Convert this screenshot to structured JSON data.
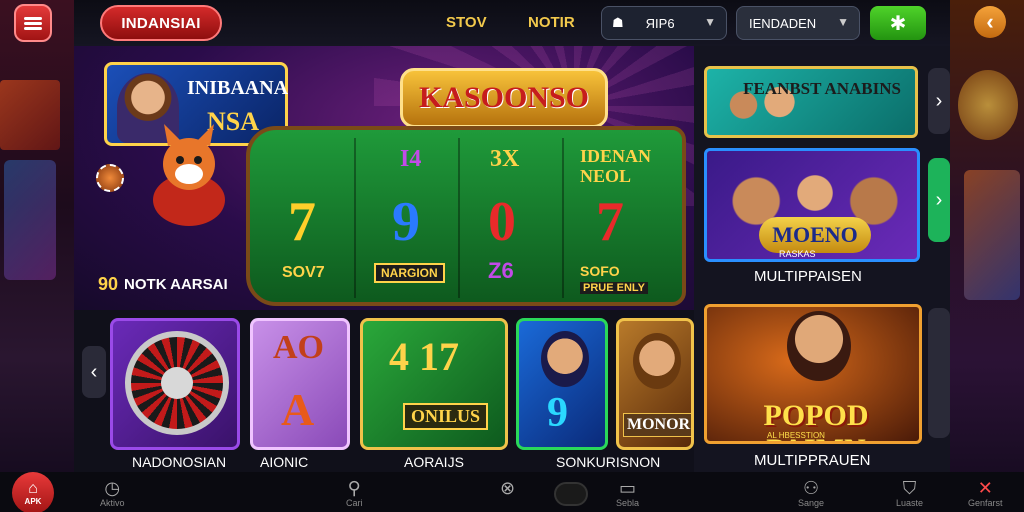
{
  "header": {
    "brand": "INDANSIAI",
    "nav": [
      "STOV",
      "NOTIR"
    ],
    "dropdown1": {
      "value": "ЯIP6",
      "icon": "robot-icon"
    },
    "dropdown2": {
      "value": "IENDADEN"
    },
    "action_button_icon": "sparkle-icon",
    "menu_icon": "hamburger-icon",
    "back_icon": "chevron-left-icon"
  },
  "hero": {
    "host_badge": {
      "line1": "INIBAANA",
      "line2": "NSA"
    },
    "sign": "KASOONSO",
    "reels": [
      {
        "head": "I4",
        "symbol": "7",
        "symbol_color": "#ffcf2a",
        "foot": "SOV7"
      },
      {
        "head": "3X",
        "symbol": "9",
        "symbol_color": "#2a7aff",
        "foot": "NARGION"
      },
      {
        "head": "",
        "symbol": "0",
        "symbol_color": "#e82a2a",
        "foot": "Z6"
      },
      {
        "head": "IDENAN NEOL",
        "symbol": "7",
        "symbol_color": "#e82a2a",
        "foot": "SOFO"
      }
    ],
    "reel_extra": "PRUE ENLY",
    "bonus": {
      "number": "90",
      "text": "NOTK AARSAI"
    }
  },
  "right": {
    "promo1": "FEANBST ANABINS",
    "promo2_logo": "MOENO",
    "promo2_sub": "RASKAS",
    "label1": "MULTIPPAISEN",
    "promo3_title": "POPOD PAIMN",
    "promo3_sub": "AL HBESSTION",
    "label2": "MULTIPPRAUEN"
  },
  "games": {
    "tiles": [
      {
        "name": "roulette"
      },
      {
        "line1": "AO",
        "line2": "A"
      },
      {
        "line1": "4 17",
        "line2": "ONILUS"
      },
      {
        "number": "9"
      },
      {
        "text": "MONOR"
      }
    ],
    "labels": [
      "NADONOSIAN",
      "AIONIC",
      "AORAIJS",
      "SONKURISNON"
    ]
  },
  "bottom_nav": {
    "apk_label": "APK",
    "items": [
      {
        "icon": "clock-icon",
        "label": "Aktivo"
      },
      {
        "icon": "search-icon",
        "label": "Cari"
      },
      {
        "icon": "spinner-icon",
        "label": ""
      },
      {
        "icon": "tv-icon",
        "label": "Sebla"
      },
      {
        "icon": "gamepad-icon",
        "label": "Sange"
      },
      {
        "icon": "bag-icon",
        "label": "Luaste"
      },
      {
        "icon": "support-icon",
        "label": "Genfarst"
      }
    ]
  },
  "colors": {
    "primary_red": "#d42a2a",
    "accent_gold": "#ffd34a",
    "accent_green": "#2ad85a",
    "background": "#120a24"
  }
}
